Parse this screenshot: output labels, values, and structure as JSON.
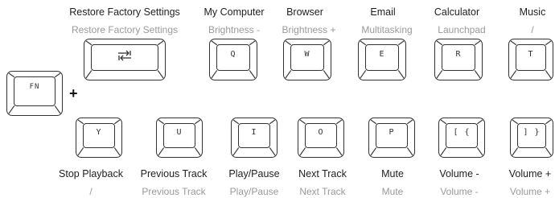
{
  "fn_key": {
    "label": "FN"
  },
  "combo_symbol": "+",
  "top_row": [
    {
      "key": "tab-icon",
      "primary": "Restore Factory Settings",
      "secondary": "Restore Factory Settings"
    },
    {
      "key": "Q",
      "primary": "My Computer",
      "secondary": "Brightness -"
    },
    {
      "key": "W",
      "primary": "Browser",
      "secondary": "Brightness +"
    },
    {
      "key": "E",
      "primary": "Email",
      "secondary": "Multitasking"
    },
    {
      "key": "R",
      "primary": "Calculator",
      "secondary": "Launchpad"
    },
    {
      "key": "T",
      "primary": "Music",
      "secondary": "/"
    }
  ],
  "bottom_row": [
    {
      "key": "Y",
      "primary": "Stop Playback",
      "secondary": "/"
    },
    {
      "key": "U",
      "primary": "Previous Track",
      "secondary": "Previous Track"
    },
    {
      "key": "I",
      "primary": "Play/Pause",
      "secondary": "Play/Pause"
    },
    {
      "key": "O",
      "primary": "Next Track",
      "secondary": "Next Track"
    },
    {
      "key": "P",
      "primary": "Mute",
      "secondary": "Mute"
    },
    {
      "key": "[ {",
      "primary": "Volume -",
      "secondary": "Volume -"
    },
    {
      "key": "] }",
      "primary": "Volume +",
      "secondary": "Volume +"
    }
  ]
}
